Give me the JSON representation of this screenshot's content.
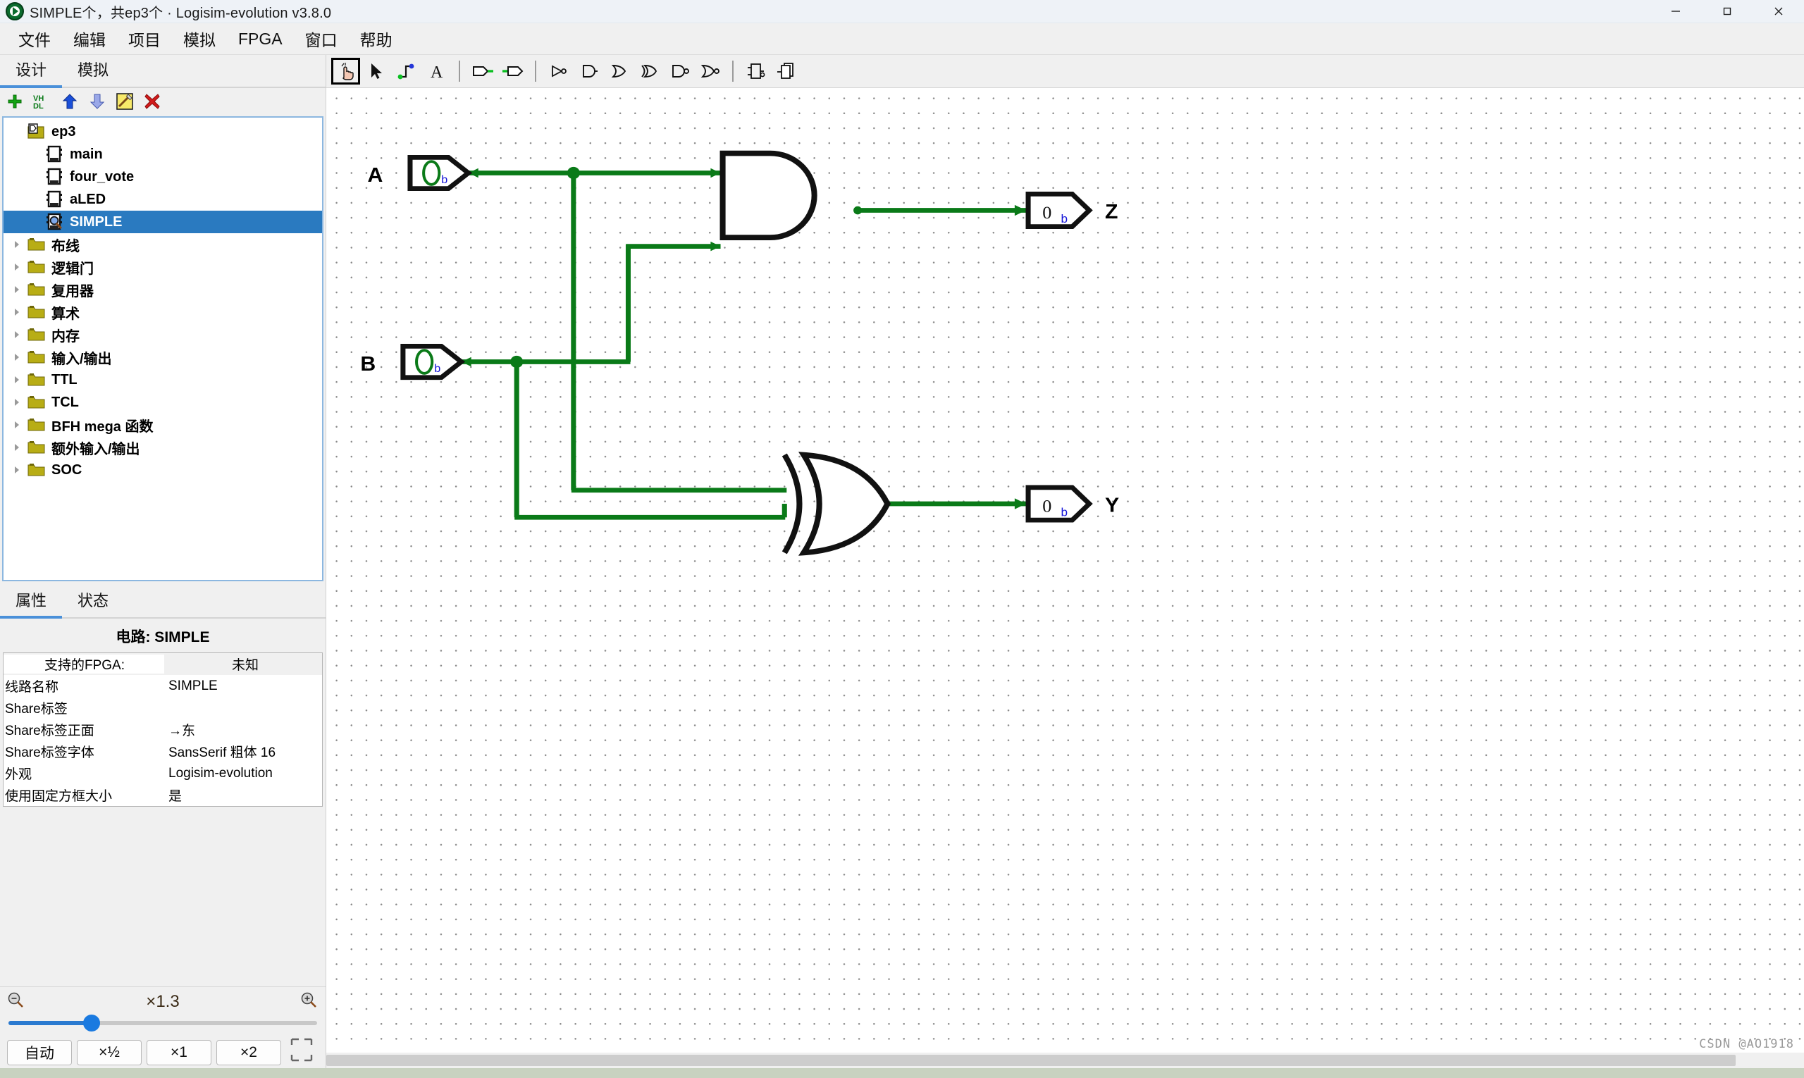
{
  "window": {
    "title": "SIMPLE个，共ep3个 · Logisim-evolution v3.8.0",
    "logo_icon": "logisim-logo-icon",
    "minimize_icon": "minimize-icon",
    "maximize_icon": "maximize-icon",
    "close_icon": "close-icon"
  },
  "menubar": {
    "items": [
      {
        "label": "文件"
      },
      {
        "label": "编辑"
      },
      {
        "label": "项目"
      },
      {
        "label": "模拟"
      },
      {
        "label": "FPGA"
      },
      {
        "label": "窗口"
      },
      {
        "label": "帮助"
      }
    ]
  },
  "explorer": {
    "tabs": [
      {
        "label": "设计",
        "active": true
      },
      {
        "label": "模拟",
        "active": false
      }
    ],
    "toolbar_icons": [
      {
        "name": "add-circuit-icon",
        "title": "+"
      },
      {
        "name": "vhdl-icon",
        "title": "VHDL"
      },
      {
        "name": "move-up-icon",
        "title": "↑"
      },
      {
        "name": "move-down-icon",
        "title": "↓"
      },
      {
        "name": "edit-icon",
        "title": "编辑"
      },
      {
        "name": "delete-icon",
        "title": "✖"
      }
    ],
    "tree": [
      {
        "label": "ep3",
        "icon": "project-icon",
        "depth": 0,
        "arrow": "",
        "selected": false
      },
      {
        "label": "main",
        "icon": "circuit-icon",
        "depth": 1,
        "arrow": "",
        "selected": false
      },
      {
        "label": "four_vote",
        "icon": "circuit-icon",
        "depth": 1,
        "arrow": "",
        "selected": false
      },
      {
        "label": "aLED",
        "icon": "circuit-icon",
        "depth": 1,
        "arrow": "",
        "selected": false
      },
      {
        "label": "SIMPLE",
        "icon": "circuit-active-icon",
        "depth": 1,
        "arrow": "",
        "selected": true
      },
      {
        "label": "布线",
        "icon": "folder-icon",
        "depth": 0,
        "arrow": "▶",
        "selected": false
      },
      {
        "label": "逻辑门",
        "icon": "folder-icon",
        "depth": 0,
        "arrow": "▶",
        "selected": false
      },
      {
        "label": "复用器",
        "icon": "folder-icon",
        "depth": 0,
        "arrow": "▶",
        "selected": false
      },
      {
        "label": "算术",
        "icon": "folder-icon",
        "depth": 0,
        "arrow": "▶",
        "selected": false
      },
      {
        "label": "内存",
        "icon": "folder-icon",
        "depth": 0,
        "arrow": "▶",
        "selected": false
      },
      {
        "label": "输入/输出",
        "icon": "folder-icon",
        "depth": 0,
        "arrow": "▶",
        "selected": false
      },
      {
        "label": "TTL",
        "icon": "folder-icon",
        "depth": 0,
        "arrow": "▶",
        "selected": false
      },
      {
        "label": "TCL",
        "icon": "folder-icon",
        "depth": 0,
        "arrow": "▶",
        "selected": false
      },
      {
        "label": "BFH mega 函数",
        "icon": "folder-icon",
        "depth": 0,
        "arrow": "▶",
        "selected": false
      },
      {
        "label": "额外输入/输出",
        "icon": "folder-icon",
        "depth": 0,
        "arrow": "▶",
        "selected": false
      },
      {
        "label": "SOC",
        "icon": "folder-icon",
        "depth": 0,
        "arrow": "▶",
        "selected": false
      }
    ]
  },
  "properties": {
    "tabs": [
      {
        "label": "属性",
        "active": true
      },
      {
        "label": "状态",
        "active": false
      }
    ],
    "heading": "电路: SIMPLE",
    "rows": [
      {
        "key": "支持的FPGA:",
        "value": "未知",
        "header": true
      },
      {
        "key": "线路名称",
        "value": "SIMPLE",
        "header": false
      },
      {
        "key": "Share标签",
        "value": "",
        "header": false
      },
      {
        "key": "Share标签正面",
        "value": "→东",
        "header": false
      },
      {
        "key": "Share标签字体",
        "value": "SansSerif 粗体 16",
        "header": false
      },
      {
        "key": "外观",
        "value": "Logisim-evolution",
        "header": false
      },
      {
        "key": "使用固定方框大小",
        "value": "是",
        "header": false
      }
    ]
  },
  "zoom_controls": {
    "zoom_out_icon": "zoom-out-icon",
    "zoom_in_icon": "zoom-in-icon",
    "level_label": "×1.3",
    "slider_percent": 27,
    "buttons": [
      {
        "label": "自动"
      },
      {
        "label": "×½"
      },
      {
        "label": "×1"
      },
      {
        "label": "×2"
      }
    ]
  },
  "canvas_toolbar": {
    "tools": [
      {
        "name": "poke-tool",
        "selected": true
      },
      {
        "name": "select-tool",
        "selected": false
      },
      {
        "name": "wiring-tool",
        "selected": false
      },
      {
        "name": "text-tool",
        "selected": false
      },
      {
        "name": "input-pin-tool",
        "selected": false
      },
      {
        "name": "output-pin-tool",
        "selected": false
      },
      {
        "name": "not-gate-tool",
        "selected": false
      },
      {
        "name": "and-gate-tool",
        "selected": false
      },
      {
        "name": "or-gate-tool",
        "selected": false
      },
      {
        "name": "xor-gate-tool",
        "selected": false
      },
      {
        "name": "nand-gate-tool",
        "selected": false
      },
      {
        "name": "nor-gate-tool",
        "selected": false
      },
      {
        "name": "add-circuit-tool",
        "selected": false
      },
      {
        "name": "duplicate-tool",
        "selected": false
      }
    ]
  },
  "circuit": {
    "wire_color": "#0a7a18",
    "pins": [
      {
        "name": "A",
        "label": "A",
        "kind": "input",
        "value": "0",
        "radix": "b"
      },
      {
        "name": "B",
        "label": "B",
        "kind": "input",
        "value": "0",
        "radix": "b"
      },
      {
        "name": "Z",
        "label": "Z",
        "kind": "output",
        "value": "0",
        "radix": "b"
      },
      {
        "name": "Y",
        "label": "Y",
        "kind": "output",
        "value": "0",
        "radix": "b"
      }
    ],
    "gates": [
      {
        "name": "and-gate",
        "type": "AND",
        "inputs": [
          "A",
          "B"
        ],
        "output": "Z"
      },
      {
        "name": "xor-gate",
        "type": "XOR",
        "inputs": [
          "A",
          "B"
        ],
        "output": "Y"
      }
    ]
  },
  "footer": {
    "watermark": "CSDN @AO1918"
  }
}
